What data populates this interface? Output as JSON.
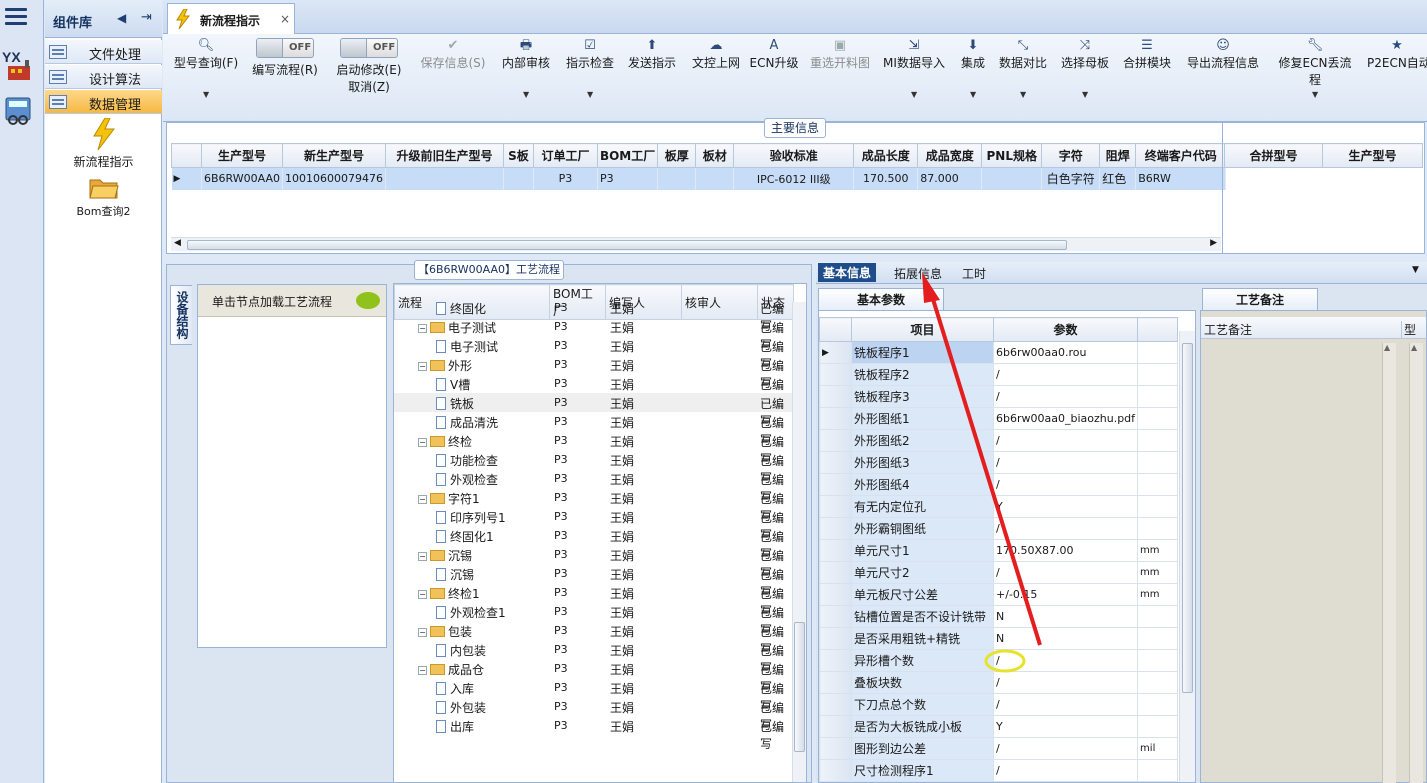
{
  "left_strip": {
    "logo_text": "YX"
  },
  "components": {
    "title": "组件库",
    "categories": [
      {
        "label": "文件处理"
      },
      {
        "label": "设计算法"
      },
      {
        "label": "数据管理"
      }
    ],
    "tools": [
      {
        "label": "新流程指示"
      },
      {
        "label": "Bom查询2"
      }
    ]
  },
  "doc_tab": {
    "label": "新流程指示",
    "close": "×"
  },
  "toolbar": {
    "items": [
      {
        "label": "型号查询(F)"
      },
      {
        "label": "编写流程(R)",
        "toggle": "OFF"
      },
      {
        "label": "启动修改(E)",
        "label2": "取消(Z)",
        "toggle": "OFF"
      },
      {
        "label": "保存信息(S)"
      },
      {
        "label": "内部审核"
      },
      {
        "label": "指示检查"
      },
      {
        "label": "发送指示"
      },
      {
        "label": "文控上网"
      },
      {
        "label": "ECN升级"
      },
      {
        "label": "重选开料图"
      },
      {
        "label": "MI数据导入"
      },
      {
        "label": "集成"
      },
      {
        "label": "数据对比"
      },
      {
        "label": "选择母板"
      },
      {
        "label": "合拼模块"
      },
      {
        "label": "导出流程信息"
      },
      {
        "label": "修复ECN丢流程"
      },
      {
        "label": "P2ECN自动"
      }
    ]
  },
  "main_info": {
    "title": "主要信息",
    "columns": [
      "生产型号",
      "新生产型号",
      "升级前旧生产型号",
      "S板",
      "订单工厂",
      "BOM工厂",
      "板厚",
      "板材",
      "验收标准",
      "成品长度",
      "成品宽度",
      "PNL规格",
      "字符",
      "阻焊",
      "终端客户代码"
    ],
    "row": [
      "6B6RW00AA0",
      "10010600079476",
      "",
      "",
      "P3",
      "P3",
      "",
      "",
      "IPC-6012 III级",
      "170.500",
      "87.000",
      "",
      "白色字符",
      "红色",
      "B6RW"
    ],
    "merge_columns": [
      "合拼型号",
      "生产型号"
    ]
  },
  "flow": {
    "title": "【6B6RW00AA0】工艺流程",
    "side_tab": "设备结构",
    "device_hint": "单击节点加载工艺流程",
    "columns": [
      "流程",
      "BOM工厂",
      "编写人",
      "核审人",
      "状态"
    ],
    "rows": [
      {
        "name": "终固化",
        "type": "file",
        "factory": "P3",
        "writer": "王娟",
        "status": "已编写"
      },
      {
        "name": "电子测试",
        "type": "folder",
        "factory": "P3",
        "writer": "王娟",
        "status": "已编写"
      },
      {
        "name": "电子测试",
        "type": "file",
        "factory": "P3",
        "writer": "王娟",
        "status": "已编写"
      },
      {
        "name": "外形",
        "type": "folder",
        "factory": "P3",
        "writer": "王娟",
        "status": "已编写"
      },
      {
        "name": "V槽",
        "type": "file",
        "factory": "P3",
        "writer": "王娟",
        "status": "已编写"
      },
      {
        "name": "铣板",
        "type": "file",
        "factory": "P3",
        "writer": "王娟",
        "status": "已编写"
      },
      {
        "name": "成品清洗",
        "type": "file",
        "factory": "P3",
        "writer": "王娟",
        "status": "已编写"
      },
      {
        "name": "终检",
        "type": "folder",
        "factory": "P3",
        "writer": "王娟",
        "status": "已编写"
      },
      {
        "name": "功能检查",
        "type": "file",
        "factory": "P3",
        "writer": "王娟",
        "status": "已编写"
      },
      {
        "name": "外观检查",
        "type": "file",
        "factory": "P3",
        "writer": "王娟",
        "status": "已编写"
      },
      {
        "name": "字符1",
        "type": "folder",
        "factory": "P3",
        "writer": "王娟",
        "status": "已编写"
      },
      {
        "name": "印序列号1",
        "type": "file",
        "factory": "P3",
        "writer": "王娟",
        "status": "已编写"
      },
      {
        "name": "终固化1",
        "type": "file",
        "factory": "P3",
        "writer": "王娟",
        "status": "已编写"
      },
      {
        "name": "沉锡",
        "type": "folder",
        "factory": "P3",
        "writer": "王娟",
        "status": "已编写"
      },
      {
        "name": "沉锡",
        "type": "file",
        "factory": "P3",
        "writer": "王娟",
        "status": "已编写"
      },
      {
        "name": "终检1",
        "type": "folder",
        "factory": "P3",
        "writer": "王娟",
        "status": "已编写"
      },
      {
        "name": "外观检查1",
        "type": "file",
        "factory": "P3",
        "writer": "王娟",
        "status": "已编写"
      },
      {
        "name": "包装",
        "type": "folder",
        "factory": "P3",
        "writer": "王娟",
        "status": "已编写"
      },
      {
        "name": "内包装",
        "type": "file",
        "factory": "P3",
        "writer": "王娟",
        "status": "已编写"
      },
      {
        "name": "成品仓",
        "type": "folder",
        "factory": "P3",
        "writer": "王娟",
        "status": "已编写"
      },
      {
        "name": "入库",
        "type": "file",
        "factory": "P3",
        "writer": "王娟",
        "status": "已编写"
      },
      {
        "name": "外包装",
        "type": "file",
        "factory": "P3",
        "writer": "王娟",
        "status": "已编写"
      },
      {
        "name": "出库",
        "type": "file",
        "factory": "P3",
        "writer": "王娟",
        "status": "已编写"
      }
    ]
  },
  "right": {
    "tabs": [
      "基本信息",
      "拓展信息",
      "工时"
    ],
    "param_tab": "基本参数",
    "param_columns": [
      "项目",
      "参数"
    ],
    "params": [
      {
        "name": "铣板程序1",
        "value": "6b6rw00aa0.rou",
        "unit": ""
      },
      {
        "name": "铣板程序2",
        "value": "/",
        "unit": ""
      },
      {
        "name": "铣板程序3",
        "value": "/",
        "unit": ""
      },
      {
        "name": "外形图纸1",
        "value": "6b6rw00aa0_biaozhu.pdf",
        "unit": ""
      },
      {
        "name": "外形图纸2",
        "value": "/",
        "unit": ""
      },
      {
        "name": "外形图纸3",
        "value": "/",
        "unit": ""
      },
      {
        "name": "外形图纸4",
        "value": "/",
        "unit": ""
      },
      {
        "name": "有无内定位孔",
        "value": "Y",
        "unit": ""
      },
      {
        "name": "外形霸铜图纸",
        "value": "/",
        "unit": ""
      },
      {
        "name": "单元尺寸1",
        "value": "170.50X87.00",
        "unit": "mm"
      },
      {
        "name": "单元尺寸2",
        "value": "/",
        "unit": "mm"
      },
      {
        "name": "单元板尺寸公差",
        "value": "+/-0.15",
        "unit": "mm"
      },
      {
        "name": "钻槽位置是否不设计铣带",
        "value": "N",
        "unit": ""
      },
      {
        "name": "是否采用粗铣+精铣",
        "value": "N",
        "unit": ""
      },
      {
        "name": "异形槽个数",
        "value": "/",
        "unit": ""
      },
      {
        "name": "叠板块数",
        "value": "/",
        "unit": ""
      },
      {
        "name": "下刀点总个数",
        "value": "/",
        "unit": ""
      },
      {
        "name": "是否为大板铣成小板",
        "value": "Y",
        "unit": ""
      },
      {
        "name": "图形到边公差",
        "value": "/",
        "unit": "mil"
      },
      {
        "name": "尺寸检测程序1",
        "value": "/",
        "unit": ""
      }
    ],
    "note_tab": "工艺备注",
    "note_columns": [
      "工艺备注",
      "型"
    ]
  }
}
